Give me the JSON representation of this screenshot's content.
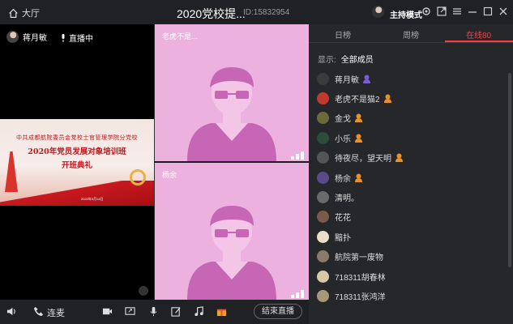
{
  "topbar": {
    "home_label": "大厅",
    "title": "2020党校提...",
    "room_id": "ID:15832954",
    "host_mode": "主持模式"
  },
  "main_video": {
    "presenter": "蒋月敏",
    "live_status": "直播中",
    "banner": {
      "line1": "中共成都航院委员会党校士官管理学院分党校",
      "line2": "2020年党员发展对象培训班",
      "line3": "开班典礼",
      "date": "2020年3月14日"
    }
  },
  "guests": [
    {
      "name": "老虎不是..."
    },
    {
      "name": "杨余"
    }
  ],
  "bottombar": {
    "mic_label": "连麦",
    "end_live": "结束直播"
  },
  "panel": {
    "tabs": [
      "日榜",
      "周榜",
      "在线80"
    ],
    "active_tab": 2,
    "filter_label": "显示:",
    "filter_value": "全部成员",
    "members": [
      {
        "name": "蒋月敏",
        "badge": "host",
        "avatar": "#3b3b3b"
      },
      {
        "name": "老虎不是猫2",
        "badge": "admin",
        "avatar": "#c0392b"
      },
      {
        "name": "金戈",
        "badge": "admin",
        "avatar": "#6b6b3a"
      },
      {
        "name": "小乐",
        "badge": "admin",
        "avatar": "#2d4d3a"
      },
      {
        "name": "待夜尽，望天明",
        "badge": "admin",
        "avatar": "#555555"
      },
      {
        "name": "杨余",
        "badge": "admin",
        "avatar": "#5a4a8a"
      },
      {
        "name": "清明。",
        "badge": "",
        "avatar": "#6a6a6a"
      },
      {
        "name": "花花",
        "badge": "",
        "avatar": "#7a5a4a"
      },
      {
        "name": "黯扑",
        "badge": "",
        "avatar": "#e8e0c8"
      },
      {
        "name": "航院第一废物",
        "badge": "",
        "avatar": "#8a7a6a"
      },
      {
        "name": "718311胡春林",
        "badge": "",
        "avatar": "#d8c8a8"
      },
      {
        "name": "718311张鸿洋",
        "badge": "",
        "avatar": "#a89878"
      }
    ]
  },
  "colors": {
    "accent": "#ff3b47",
    "guest_bg": "#ecb1df",
    "badge_host": "#7b5cd6",
    "badge_admin": "#e8902a"
  }
}
